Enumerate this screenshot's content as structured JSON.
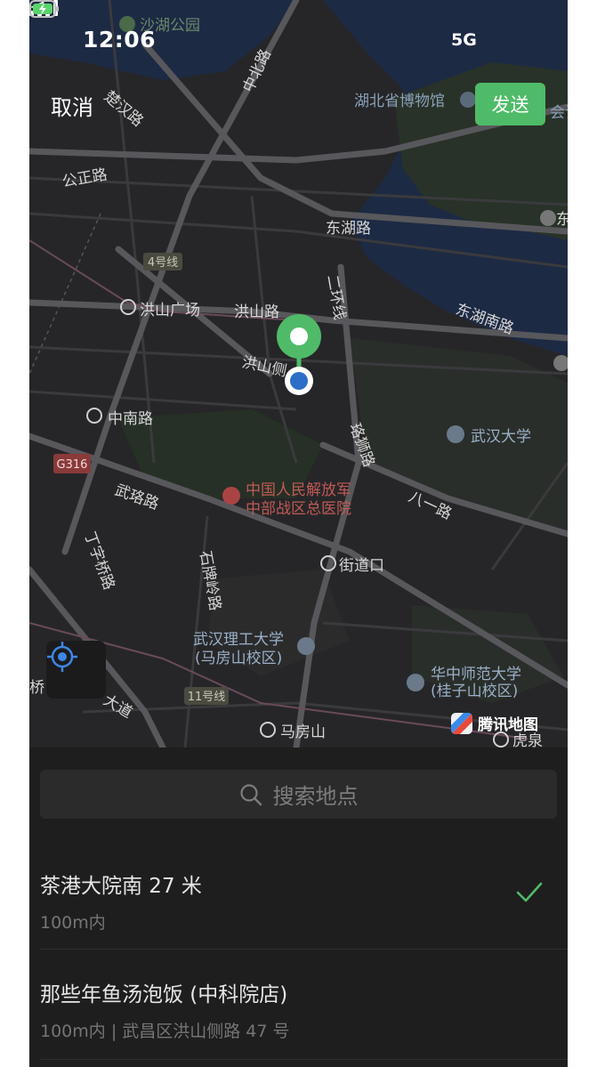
{
  "status_bar": {
    "time": "12:06",
    "network": "5G"
  },
  "nav": {
    "cancel_label": "取消",
    "send_label": "发送"
  },
  "map": {
    "labels": {
      "shahu_park": "沙湖公园",
      "museum": "湖北省博物馆",
      "chuhan_rd": "楚汉路",
      "zhongbei_rd": "中北路",
      "gongzheng_rd": "公正路",
      "donghu_rd": "东湖路",
      "line4": "4号线",
      "second_ring": "二环线",
      "hongshan_square": "洪山广场",
      "hongshan_rd": "洪山路",
      "donghu_south_rd": "东湖南路",
      "hongshan_side": "洪山侧",
      "zhongnan_rd": "中南路",
      "luoshi_rd": "珞狮路",
      "whu": "武汉大学",
      "g316": "G316",
      "hospital_1": "中国人民解放军",
      "hospital_2": "中部战区总医院",
      "wuluo_rd": "武珞路",
      "bayi_rd": "八一路",
      "dingzi_bridge_rd": "丁字桥路",
      "jiedaokou": "街道口",
      "shipailing_rd": "石牌岭路",
      "whut_1": "武汉理工大学",
      "whut_2": "(马房山校区)",
      "ccnu_1": "华中师范大学",
      "ccnu_2": "(桂子山校区)",
      "line11": "11号线",
      "dadao": "大道",
      "qiao": "桥",
      "mafangshan": "马房山",
      "huquan": "虎泉",
      "edge_1": "东",
      "edge_2": "会议"
    },
    "brand": "腾讯地图"
  },
  "search": {
    "placeholder": "搜索地点"
  },
  "results": [
    {
      "title": "茶港大院南 27 米",
      "subtitle": "100m内",
      "selected": true
    },
    {
      "title": "那些年鱼汤泡饭 (中科院店)",
      "subtitle": "100m内 | 武昌区洪山侧路 47 号",
      "selected": false
    }
  ],
  "colors": {
    "accent": "#4fbb68",
    "map_bg": "#262628",
    "panel_bg": "#1e1e1e",
    "pin": "#4fbb68",
    "user_dot": "#2d6fc7"
  }
}
